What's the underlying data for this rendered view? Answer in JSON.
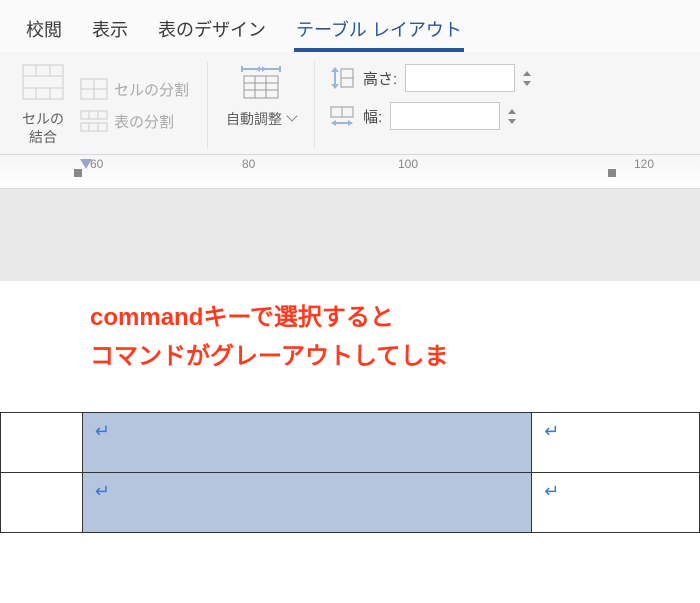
{
  "tabs": {
    "review": "校閲",
    "view": "表示",
    "table_design": "表のデザイン",
    "table_layout": "テーブル レイアウト"
  },
  "ribbon": {
    "merge_cells_line1": "セルの",
    "merge_cells_line2": "結合",
    "split_cells": "セルの分割",
    "split_table": "表の分割",
    "autofit": "自動調整",
    "height_label": "高さ:",
    "width_label": "幅:",
    "height_value": "",
    "width_value": ""
  },
  "ruler": {
    "n60": "60",
    "n80": "80",
    "n100": "100",
    "n120": "120"
  },
  "annotation": {
    "line1": "commandキーで選択すると",
    "line2": "コマンドがグレーアウトしてしま"
  }
}
